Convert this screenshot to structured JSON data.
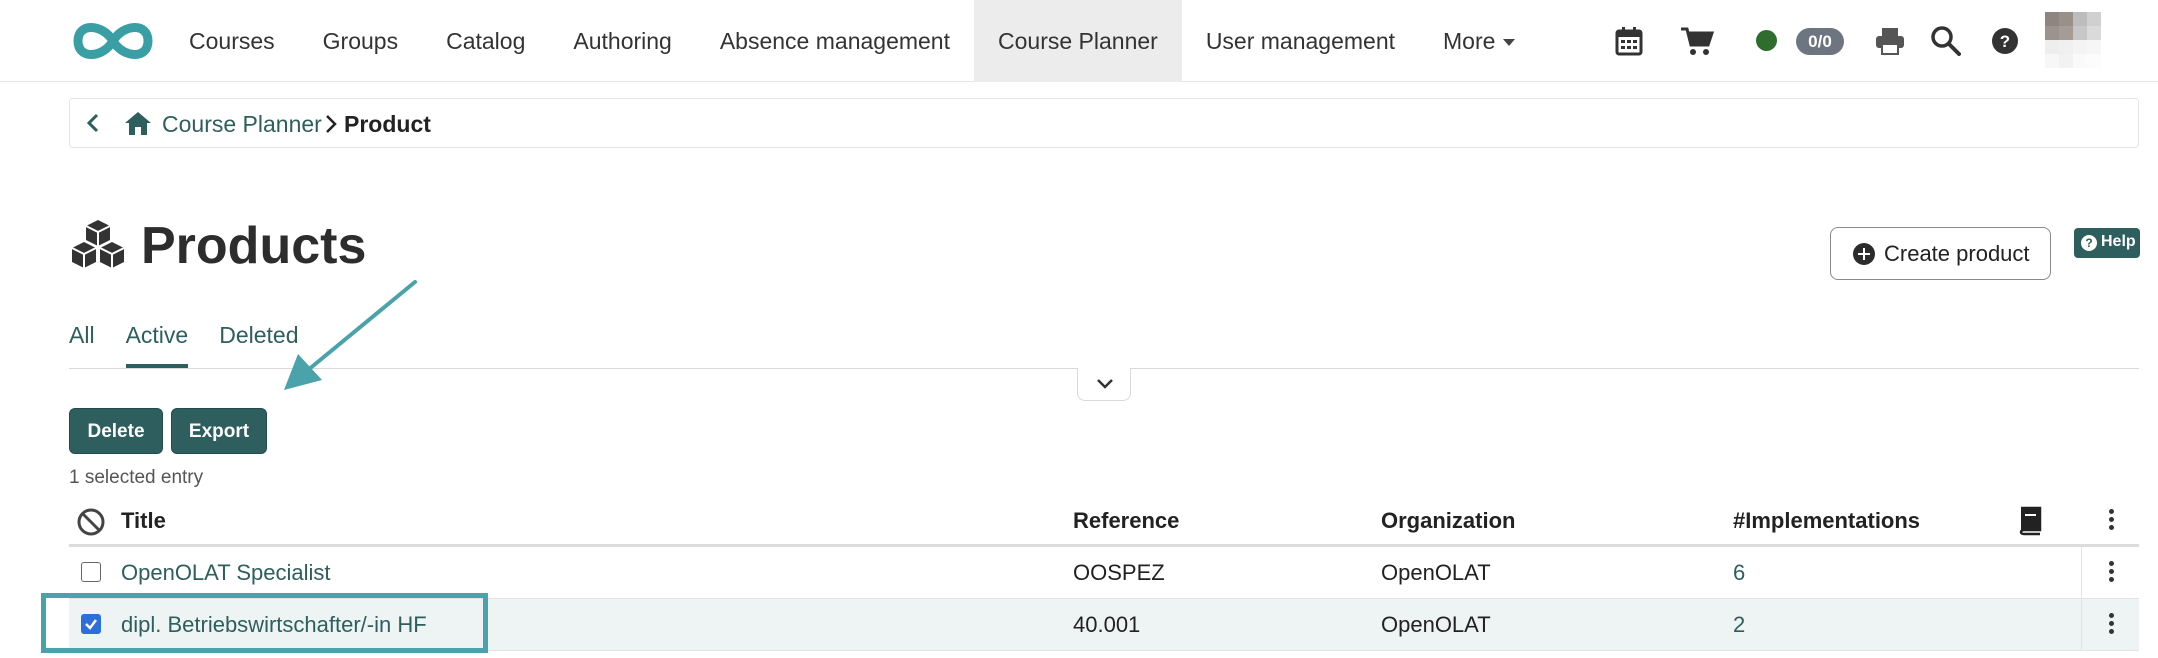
{
  "nav": {
    "items": [
      {
        "label": "Courses",
        "active": false
      },
      {
        "label": "Groups",
        "active": false
      },
      {
        "label": "Catalog",
        "active": false
      },
      {
        "label": "Authoring",
        "active": false
      },
      {
        "label": "Absence management",
        "active": false
      },
      {
        "label": "Course Planner",
        "active": true
      },
      {
        "label": "User management",
        "active": false
      },
      {
        "label": "More",
        "active": false
      }
    ],
    "badge": "0/0",
    "status_color": "#2e6d2e",
    "icons": [
      "calendar-icon",
      "cart-icon",
      "print-icon",
      "search-icon",
      "help-icon"
    ]
  },
  "breadcrumb": {
    "parent": "Course Planner",
    "current": "Product"
  },
  "page": {
    "title": "Products",
    "create_label": "Create product",
    "help_label": "Help"
  },
  "tabs": [
    {
      "label": "All",
      "active": false
    },
    {
      "label": "Active",
      "active": true
    },
    {
      "label": "Deleted",
      "active": false
    }
  ],
  "actions": {
    "delete_label": "Delete",
    "export_label": "Export",
    "selected_info": "1 selected entry"
  },
  "table": {
    "columns": {
      "title": "Title",
      "reference": "Reference",
      "organization": "Organization",
      "implementations": "#Implementations"
    },
    "rows": [
      {
        "title": "OpenOLAT Specialist",
        "reference": "OOSPEZ",
        "organization": "OpenOLAT",
        "implementations": "6",
        "checked": false
      },
      {
        "title": "dipl. Betriebswirtschafter/-in HF",
        "reference": "40.001",
        "organization": "OpenOLAT",
        "implementations": "2",
        "checked": true
      }
    ]
  },
  "colors": {
    "accent": "#2e5e5e",
    "annotation": "#4aa3ab"
  }
}
